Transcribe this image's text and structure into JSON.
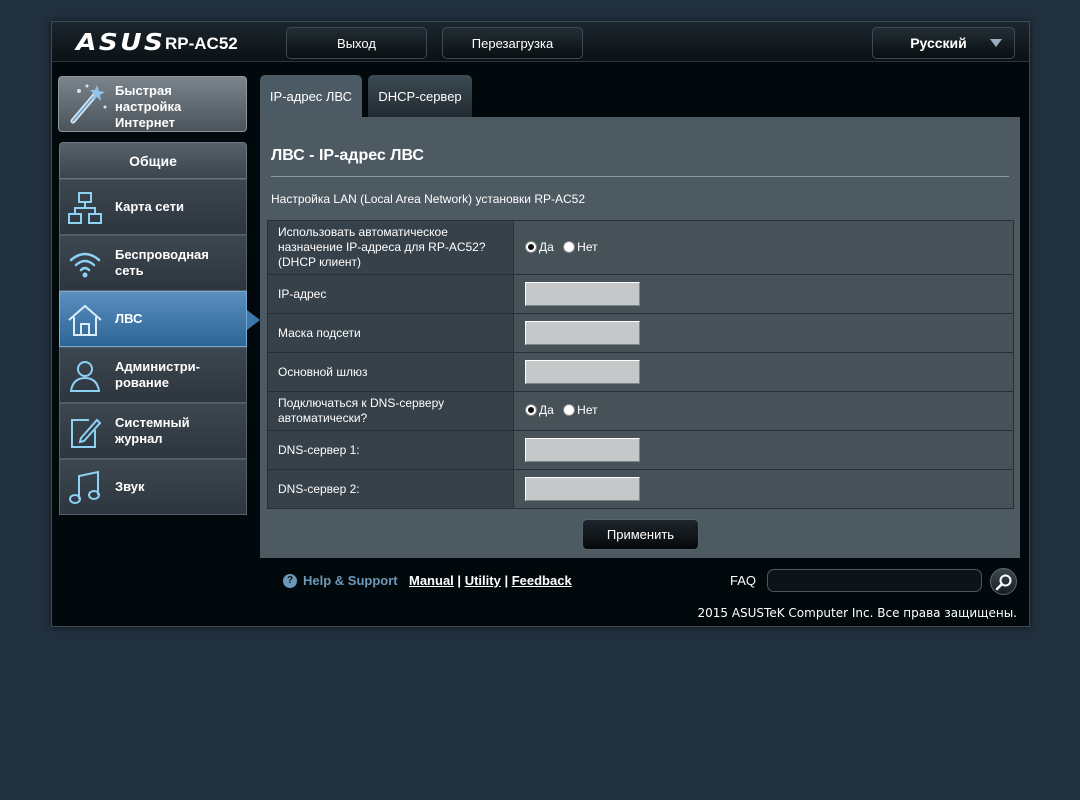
{
  "header": {
    "logo": "ASUS",
    "model": "RP-AC52",
    "logout_label": "Выход",
    "reboot_label": "Перезагрузка",
    "language": "Русский"
  },
  "sidebar": {
    "quick_setup": [
      "Быстрая",
      "настройка",
      "Интернет"
    ],
    "general_label": "Общие",
    "items": [
      {
        "label": "Карта сети",
        "icon": "network-map-icon"
      },
      {
        "label": "Беспроводная сеть",
        "icon": "wifi-icon"
      },
      {
        "label": "ЛВС",
        "icon": "home-icon",
        "active": true
      },
      {
        "label": "Администри-рование",
        "icon": "admin-user-icon"
      },
      {
        "label": "Системный журнал",
        "icon": "log-edit-icon"
      },
      {
        "label": "Звук",
        "icon": "music-note-icon"
      }
    ],
    "item_lines": {
      "network_map": "Карта сети",
      "wireless_1": "Беспроводная",
      "wireless_2": "сеть",
      "lan": "ЛВС",
      "admin_1": "Администри-",
      "admin_2": "рование",
      "syslog_1": "Системный",
      "syslog_2": "журнал",
      "sound": "Звук"
    }
  },
  "tabs": [
    {
      "label": "IP-адрес ЛВС",
      "active": true
    },
    {
      "label": "DHCP-сервер",
      "active": false
    }
  ],
  "main": {
    "title": "ЛВС - IP-адрес ЛВС",
    "description": "Настройка LAN (Local Area Network) установки RP-AC52",
    "rows": {
      "auto_ip_l1": "Использовать автоматическое",
      "auto_ip_l2": "назначение IP-адреса для RP-AC52?",
      "auto_ip_l3": "(DHCP клиент)",
      "ip": "IP-адрес",
      "mask": "Маска подсети",
      "gateway": "Основной шлюз",
      "dns_auto_l1": "Подключаться к DNS-серверу",
      "dns_auto_l2": "автоматически?",
      "dns1": "DNS-сервер 1:",
      "dns2": "DNS-сервер 2:"
    },
    "radio_yes": "Да",
    "radio_no": "Нет",
    "auto_ip_selected": "Да",
    "dns_auto_selected": "Да",
    "values": {
      "ip": "",
      "mask": "",
      "gateway": "",
      "dns1": "",
      "dns2": ""
    },
    "apply_label": "Применить"
  },
  "footer": {
    "help_label": "Help & Support",
    "manual": "Manual",
    "utility": "Utility",
    "feedback": "Feedback",
    "separator": "|",
    "faq_label": "FAQ",
    "faq_value": "",
    "copyright": "2015 ASUSTeK Computer Inc. Все права защищены."
  },
  "colors": {
    "page_bg": "#21303d",
    "accent_active": "#3c77a9",
    "help_link": "#6e98b8"
  }
}
